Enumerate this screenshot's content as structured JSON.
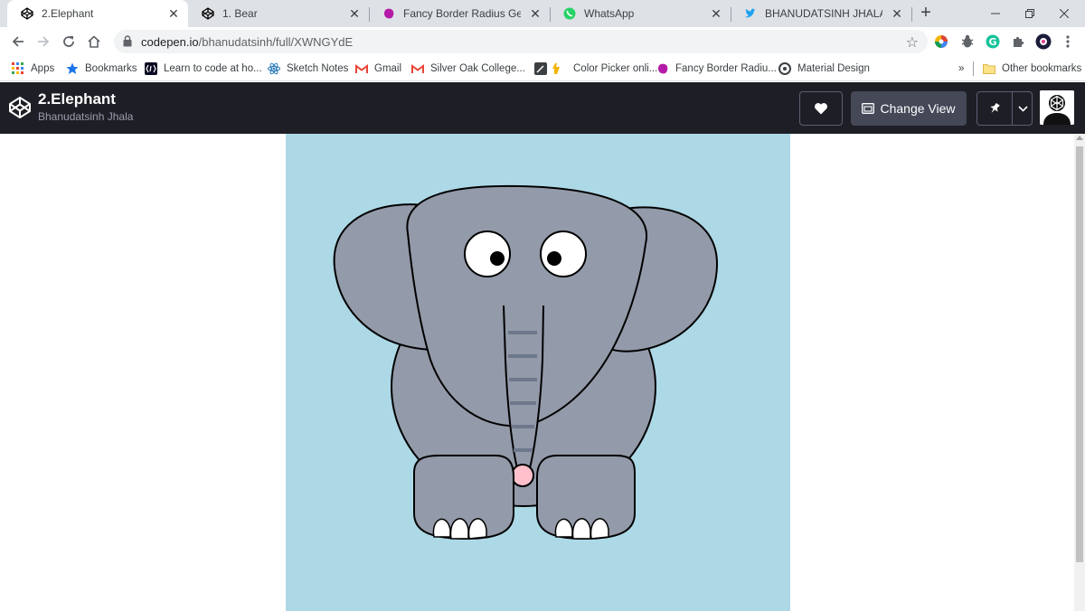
{
  "tabs": [
    {
      "title": "2.Elephant",
      "icon": "codepen-icon",
      "active": true
    },
    {
      "title": "1. Bear",
      "icon": "codepen-icon",
      "active": false
    },
    {
      "title": "Fancy Border Radius Generator",
      "icon": "fancy-border-icon",
      "active": false
    },
    {
      "title": "WhatsApp",
      "icon": "whatsapp-icon",
      "active": false
    },
    {
      "title": "BHANUDATSINH JHALA (@bha",
      "icon": "twitter-icon",
      "active": false
    }
  ],
  "address_bar": {
    "url_host": "codepen.io",
    "url_path": "/bhanudatsinh/full/XWNGYdE"
  },
  "bookmarks": {
    "apps": "Apps",
    "items": [
      {
        "label": "Bookmarks",
        "icon": "star-icon"
      },
      {
        "label": "Learn to code at ho...",
        "icon": "freecodecamp-icon"
      },
      {
        "label": "Sketch Notes",
        "icon": "react-icon"
      },
      {
        "label": "Gmail",
        "icon": "gmail-icon"
      },
      {
        "label": "Silver Oak College...",
        "icon": "gmail-icon"
      },
      {
        "label": "Color Picker onli...",
        "icon": "color-picker-icon"
      },
      {
        "label": "Fancy Border Radiu...",
        "icon": "fancy-border-icon"
      },
      {
        "label": "Material Design",
        "icon": "material-icon"
      }
    ],
    "overflow": "»",
    "other": "Other bookmarks"
  },
  "codepen": {
    "title": "2.Elephant",
    "author": "Bhanudatsinh Jhala",
    "change_view": "Change View"
  },
  "colors": {
    "stage_bg": "#add8e6",
    "elephant_body": "#939aa9",
    "trunk_stripe": "#6e788c",
    "trunk_tip": "#ffc0cb",
    "codepen_header": "#1e1f26"
  }
}
